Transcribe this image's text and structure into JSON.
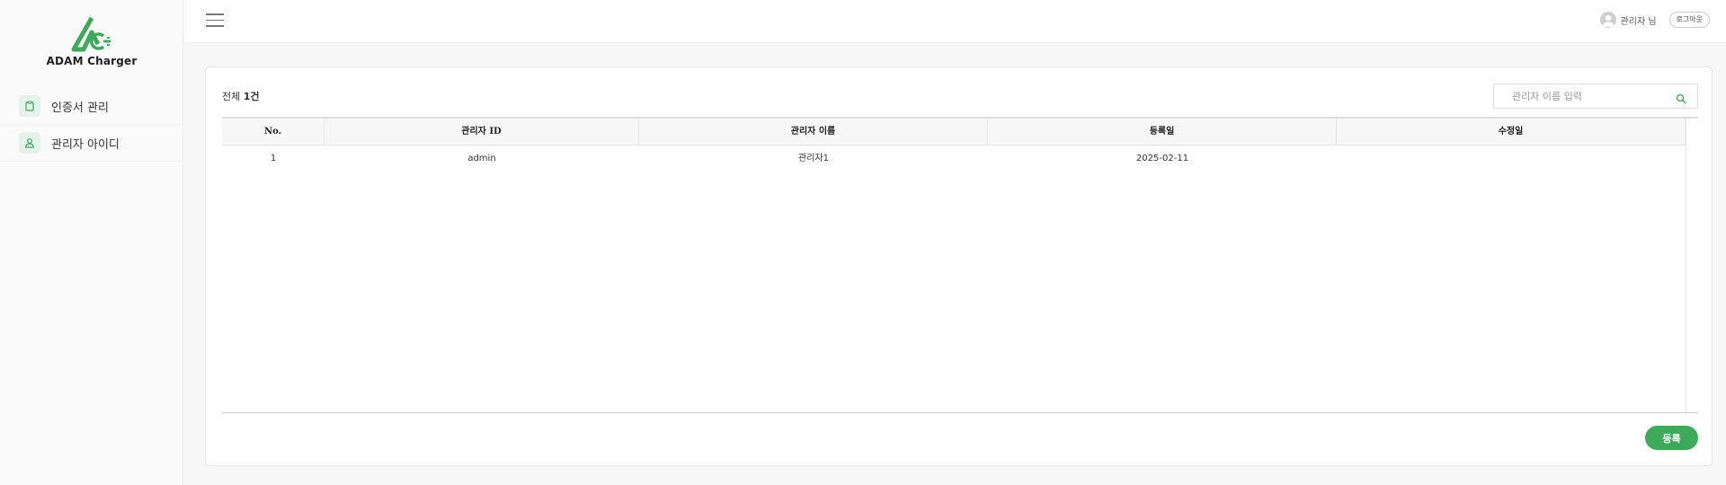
{
  "logo": {
    "text": "ADAM Charger",
    "icon": "adam-charger-logo"
  },
  "sidebar": {
    "items": [
      {
        "label": "인증서 관리",
        "icon": "clipboard-icon"
      },
      {
        "label": "관리자 아이디",
        "icon": "user-icon"
      }
    ]
  },
  "header": {
    "menu_icon": "hamburger-icon",
    "user_name": "관리자 님",
    "logout_label": "로그아웃"
  },
  "list": {
    "count_prefix": "전체",
    "count_value": "1건",
    "search_placeholder": "관리자 이름 입력",
    "columns": [
      "No.",
      "관리자 ID",
      "관리자 이름",
      "등록일",
      "수정일"
    ],
    "rows": [
      [
        "1",
        "admin",
        "관리자1",
        "2025-02-11",
        ""
      ]
    ],
    "register_label": "등록"
  },
  "colors": {
    "accent": "#3daa5a",
    "accent_light": "#e3f3e8"
  }
}
